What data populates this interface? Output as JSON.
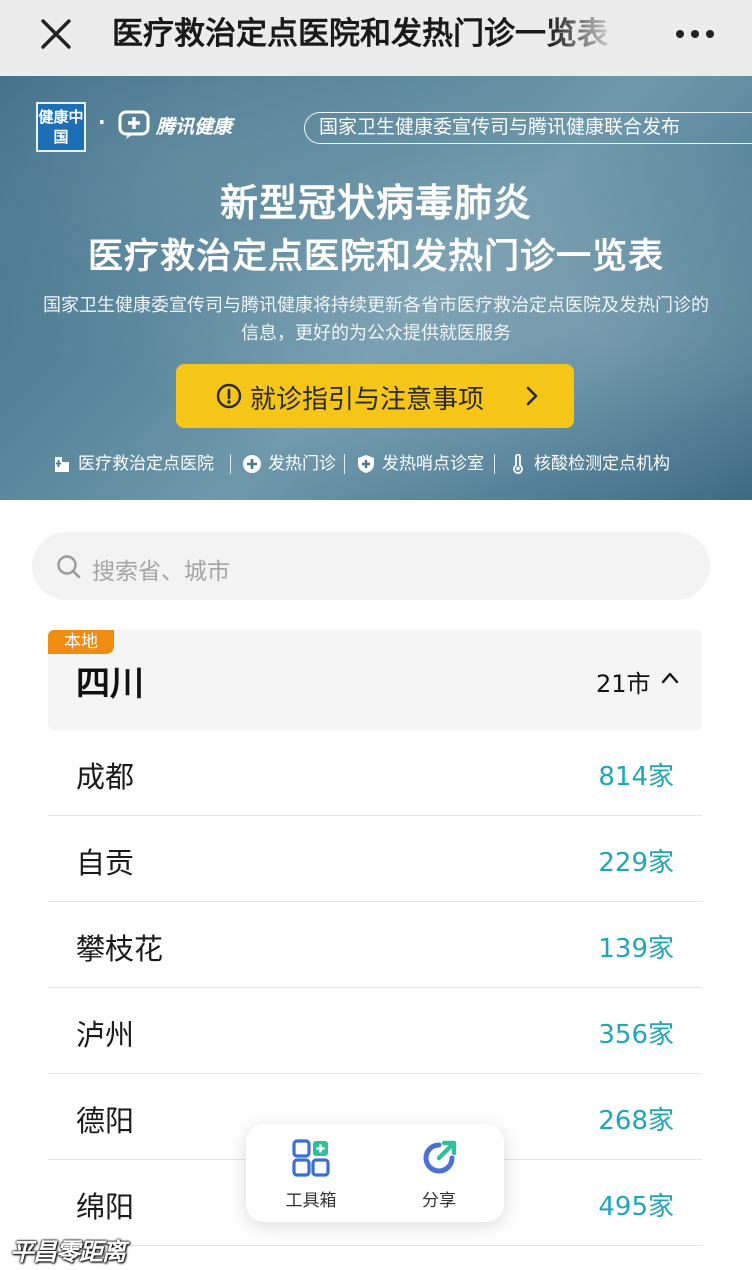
{
  "navbar": {
    "title": "医疗救治定点医院和发热门诊一览表",
    "close_icon": "close-icon",
    "more_icon": "more-icon"
  },
  "banner": {
    "logo_jkzg": "健康中国",
    "logo_dot": "·",
    "logo_tx": "腾讯健康",
    "publisher": "国家卫生健康委宣传司与腾讯健康联合发布",
    "title_line1": "新型冠状病毒肺炎",
    "title_line2": "医疗救治定点医院和发热门诊一览表",
    "description": "国家卫生健康委宣传司与腾讯健康将持续更新各省市医疗救治定点医院及发热门诊的信息，更好的为公众提供就医服务",
    "guide_button": "就诊指引与注意事项",
    "legend": [
      {
        "label": "医疗救治定点医院",
        "icon": "hospital-icon"
      },
      {
        "label": "发热门诊",
        "icon": "plus-icon"
      },
      {
        "label": "发热哨点诊室",
        "icon": "shield-icon"
      },
      {
        "label": "核酸检测定点机构",
        "icon": "thermometer-icon"
      }
    ],
    "colors": {
      "guide_button": "#f5c518"
    }
  },
  "search": {
    "placeholder": "搜索省、城市"
  },
  "province": {
    "badge": "本地",
    "name": "四川",
    "count": "21市",
    "expanded": true
  },
  "cities": [
    {
      "name": "成都",
      "count": "814家"
    },
    {
      "name": "自贡",
      "count": "229家"
    },
    {
      "name": "攀枝花",
      "count": "139家"
    },
    {
      "name": "泸州",
      "count": "356家"
    },
    {
      "name": "德阳",
      "count": "268家"
    },
    {
      "name": "绵阳",
      "count": "495家"
    }
  ],
  "toolbar": {
    "items": [
      {
        "label": "工具箱",
        "icon": "toolbox-icon"
      },
      {
        "label": "分享",
        "icon": "share-icon"
      }
    ]
  },
  "watermark": "平昌零距离",
  "colors": {
    "accent": "#1fa6b8",
    "badge": "#f08c12"
  }
}
